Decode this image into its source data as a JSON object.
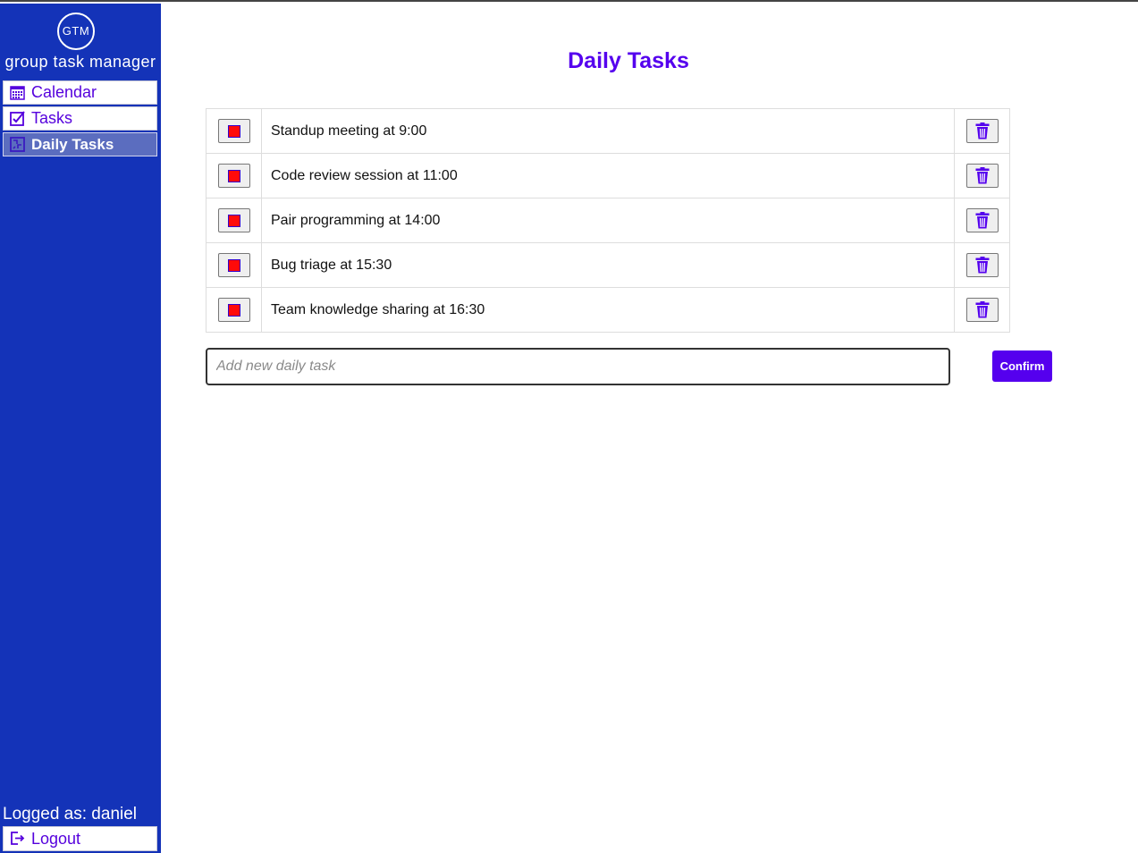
{
  "app": {
    "logo_text": "GTM",
    "name": "group task manager"
  },
  "sidebar": {
    "items": [
      {
        "label": "Calendar",
        "icon": "calendar-icon",
        "active": false
      },
      {
        "label": "Tasks",
        "icon": "checkbox-icon",
        "active": false
      },
      {
        "label": "Daily Tasks",
        "icon": "daily-icon",
        "active": true
      }
    ],
    "logged_as": "Logged as: daniel",
    "logout_label": "Logout"
  },
  "main": {
    "title": "Daily Tasks",
    "tasks": [
      {
        "text": "Standup meeting at 9:00"
      },
      {
        "text": "Code review session at 11:00"
      },
      {
        "text": "Pair programming at 14:00"
      },
      {
        "text": "Bug triage at 15:30"
      },
      {
        "text": "Team knowledge sharing at 16:30"
      }
    ],
    "input_placeholder": "Add new daily task",
    "confirm_label": "Confirm"
  },
  "colors": {
    "sidebar_bg": "#1433b8",
    "accent": "#5500ee",
    "status_box": "#ff0a0a"
  }
}
